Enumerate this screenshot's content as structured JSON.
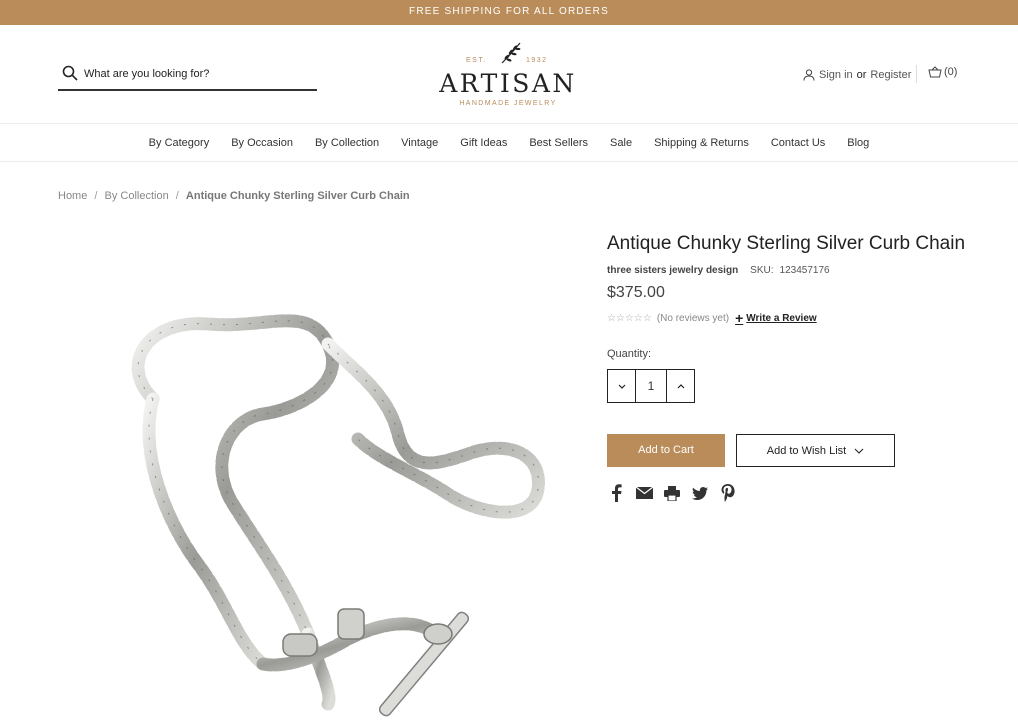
{
  "promo": {
    "text": "FREE SHIPPING FOR ALL ORDERS"
  },
  "header": {
    "search_placeholder": "What are you looking for?",
    "logo": {
      "est": "EST.",
      "year": "1932",
      "brand": "ARTISAN",
      "tagline": "HANDMADE JEWELRY"
    },
    "account": {
      "sign_in": "Sign in",
      "or": "or",
      "register": "Register"
    },
    "cart": {
      "count": "(0)"
    }
  },
  "nav": {
    "items": [
      "By Category",
      "By Occasion",
      "By Collection",
      "Vintage",
      "Gift Ideas",
      "Best Sellers",
      "Sale",
      "Shipping & Returns",
      "Contact Us",
      "Blog"
    ]
  },
  "breadcrumb": {
    "items": [
      "Home",
      "By Collection",
      "Antique Chunky Sterling Silver Curb Chain"
    ]
  },
  "product": {
    "title": "Antique Chunky Sterling Silver Curb Chain",
    "brand": "three sisters jewelry design",
    "sku_label": "SKU:",
    "sku": "123457176",
    "price": "$375.00",
    "stars": "☆☆☆☆☆",
    "reviews_text": "(No reviews yet)",
    "write_review": "Write a Review",
    "quantity_label": "Quantity:",
    "quantity": "1",
    "add_to_cart": "Add to Cart",
    "add_to_wishlist": "Add to Wish List"
  },
  "share_icons": [
    "facebook-icon",
    "email-icon",
    "print-icon",
    "twitter-icon",
    "pinterest-icon"
  ],
  "colors": {
    "accent": "#b98c5a",
    "text": "#222222"
  }
}
